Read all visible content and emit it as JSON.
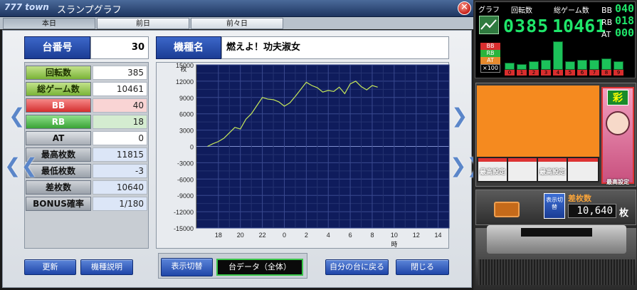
{
  "window": {
    "brand": "777 town",
    "title": "スランプグラフ",
    "close_symbol": "✕"
  },
  "tabs": [
    {
      "label": "本日"
    },
    {
      "label": "前日"
    },
    {
      "label": "前々日"
    }
  ],
  "machine": {
    "number_label": "台番号",
    "number_value": "30",
    "name_label": "機種名",
    "name_value": "燃えよ！功夫淑女"
  },
  "stats": [
    {
      "label": "回転数",
      "value": "385"
    },
    {
      "label": "総ゲーム数",
      "value": "10461"
    },
    {
      "label": "BB",
      "value": "40"
    },
    {
      "label": "RB",
      "value": "18"
    },
    {
      "label": "AT",
      "value": "0"
    },
    {
      "label": "最高枚数",
      "value": "11815"
    },
    {
      "label": "最低枚数",
      "value": "-3"
    },
    {
      "label": "差枚数",
      "value": "10640"
    },
    {
      "label": "BONUS確率",
      "value": "1/180"
    }
  ],
  "chart_data": {
    "type": "line",
    "ylabel": "枚",
    "xlabel": "時",
    "ylim": [
      -15000,
      15000
    ],
    "yticks": [
      "15000",
      "12000",
      "9000",
      "6000",
      "3000",
      "0",
      "-3000",
      "-6000",
      "-9000",
      "-12000",
      "-15000"
    ],
    "xticks": [
      "18",
      "20",
      "22",
      "0",
      "2",
      "4",
      "6",
      "8",
      "10",
      "12",
      "14"
    ],
    "grid": true,
    "x": [
      17,
      17.5,
      18,
      18.5,
      19,
      19.5,
      20,
      20.5,
      21,
      21.5,
      22,
      22.5,
      23,
      23.5,
      24,
      24.5,
      25,
      25.5,
      26,
      26.5,
      27,
      27.5,
      28,
      28.5,
      29,
      29.5,
      30,
      30.5,
      31,
      31.5,
      32,
      32.5
    ],
    "values": [
      0,
      500,
      900,
      1500,
      2500,
      3500,
      3200,
      5000,
      6000,
      7500,
      9000,
      8700,
      8600,
      8200,
      7400,
      8000,
      9200,
      10500,
      11800,
      11200,
      10800,
      10000,
      10300,
      10100,
      10900,
      9700,
      11500,
      12000,
      11000,
      10400,
      11200,
      10900
    ],
    "line_color": "#c6e85a",
    "background": "#0f1c5c"
  },
  "buttons": {
    "update": "更新",
    "machine_desc": "機種説明",
    "toggle_display": "表示切替",
    "unit_data": "台データ（全体）",
    "return_own": "自分の台に戻る",
    "close": "閉じる"
  },
  "right_panel": {
    "graph_label": "グラフ",
    "spins_label": "回転数",
    "total_label": "総ゲーム数",
    "spins_value": "0385",
    "total_value": "10461",
    "bb_label": "BB",
    "bb_value": "040",
    "rb_label": "RB",
    "rb_value": "018",
    "at_label": "AT",
    "at_value": "000",
    "legend": [
      "BB",
      "RB",
      "AT",
      "×100"
    ],
    "bar_indexes": [
      "0",
      "1",
      "2",
      "3",
      "4",
      "5",
      "6",
      "7",
      "8",
      "9"
    ],
    "bar_heights": [
      0.25,
      0.2,
      0.3,
      0.35,
      1.0,
      0.3,
      0.35,
      0.35,
      0.4,
      0.3
    ],
    "reel_labels": [
      "最高設定",
      "",
      "最高設定",
      ""
    ],
    "char_label": "彩",
    "char_sub": "最高設定",
    "display_switch": "表示切替",
    "diff_label": "差枚数",
    "diff_value": "10,640",
    "diff_unit": "枚"
  }
}
